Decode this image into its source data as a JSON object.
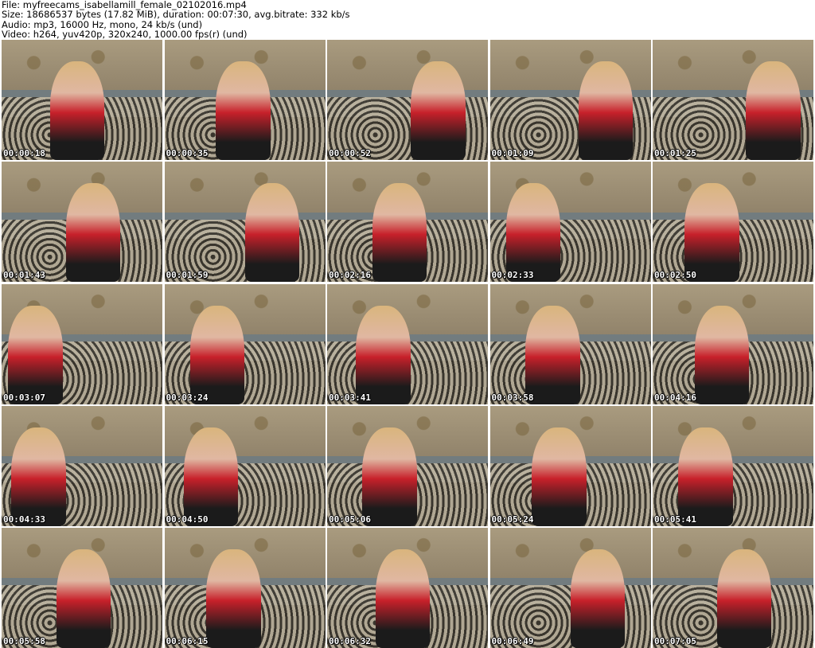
{
  "header": {
    "file_line": "File: myfreecams_isabellamill_female_02102016.mp4",
    "size_line": "Size: 18686537 bytes (17.82 MiB), duration: 00:07:30, avg.bitrate: 332 kb/s",
    "audio_line": "Audio: mp3, 16000 Hz, mono, 24 kb/s (und)",
    "video_line": "Video: h264, yuv420p, 320x240, 1000.00 fps(r) (und)"
  },
  "thumbnails": [
    {
      "timestamp": "00:00:18"
    },
    {
      "timestamp": "00:00:35"
    },
    {
      "timestamp": "00:00:52"
    },
    {
      "timestamp": "00:01:09"
    },
    {
      "timestamp": "00:01:25"
    },
    {
      "timestamp": "00:01:43"
    },
    {
      "timestamp": "00:01:59"
    },
    {
      "timestamp": "00:02:16"
    },
    {
      "timestamp": "00:02:33"
    },
    {
      "timestamp": "00:02:50"
    },
    {
      "timestamp": "00:03:07"
    },
    {
      "timestamp": "00:03:24"
    },
    {
      "timestamp": "00:03:41"
    },
    {
      "timestamp": "00:03:58"
    },
    {
      "timestamp": "00:04:16"
    },
    {
      "timestamp": "00:04:33"
    },
    {
      "timestamp": "00:04:50"
    },
    {
      "timestamp": "00:05:06"
    },
    {
      "timestamp": "00:05:24"
    },
    {
      "timestamp": "00:05:41"
    },
    {
      "timestamp": "00:05:58"
    },
    {
      "timestamp": "00:06:15"
    },
    {
      "timestamp": "00:06:32"
    },
    {
      "timestamp": "00:06:49"
    },
    {
      "timestamp": "00:07:05"
    }
  ]
}
